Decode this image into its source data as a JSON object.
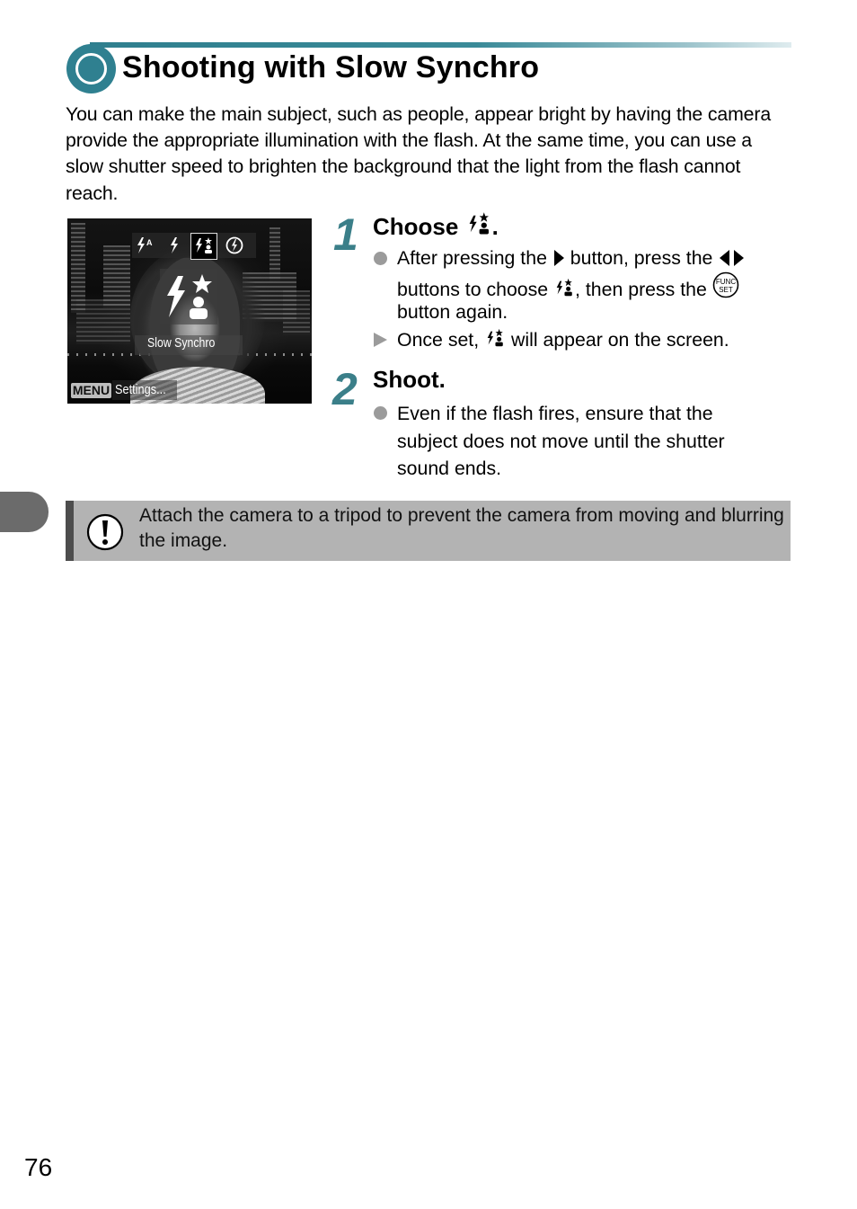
{
  "header": {
    "title": "Shooting with Slow Synchro",
    "accent_color": "#2f8090"
  },
  "intro": "You can make the main subject, such as people, appear bright by having the camera provide the appropriate illumination with the flash. At the same time, you can use a slow shutter speed to brighten the background that the light from the flash cannot reach.",
  "camera_screen": {
    "flash_modes": [
      "auto-flash-icon",
      "flash-on-icon",
      "slow-synchro-icon",
      "flash-off-icon"
    ],
    "selected_mode": "slow-synchro-icon",
    "selected_label": "Slow Synchro",
    "menu_label": "MENU",
    "menu_action": "Settings..."
  },
  "steps": [
    {
      "number": "1",
      "title": "Choose",
      "title_icon": "slow-synchro-icon",
      "title_suffix": ".",
      "bullets": [
        {
          "type": "action",
          "lines": [
            {
              "parts": [
                "After pressing the ",
                "{right-button-icon}",
                " button, press the ",
                "{left-right-buttons-icon}"
              ]
            },
            {
              "parts": [
                "buttons to choose ",
                "{slow-synchro-icon}",
                ", then press the ",
                "{func-set-button-icon}"
              ]
            },
            {
              "parts": [
                "button again."
              ]
            }
          ],
          "seg": {
            "l1a": "After pressing the ",
            "l1b": " button, press the ",
            "l2a": "buttons to choose ",
            "l2b": ", then press the ",
            "l3": "button again."
          }
        },
        {
          "type": "result",
          "seg": {
            "a": "Once set, ",
            "b": " will appear on the screen."
          }
        }
      ]
    },
    {
      "number": "2",
      "title": "Shoot.",
      "bullets": [
        {
          "type": "action",
          "lines": [
            "Even if the flash fires, ensure that the",
            "subject does not move until the shutter",
            "sound ends."
          ]
        }
      ]
    }
  ],
  "note": {
    "icon": "caution-icon",
    "text": "Attach the camera to a tripod to prevent the camera from moving and blurring the image."
  },
  "func_set_label_top": "FUNC",
  "func_set_label_bottom": "SET",
  "page_number": "76"
}
